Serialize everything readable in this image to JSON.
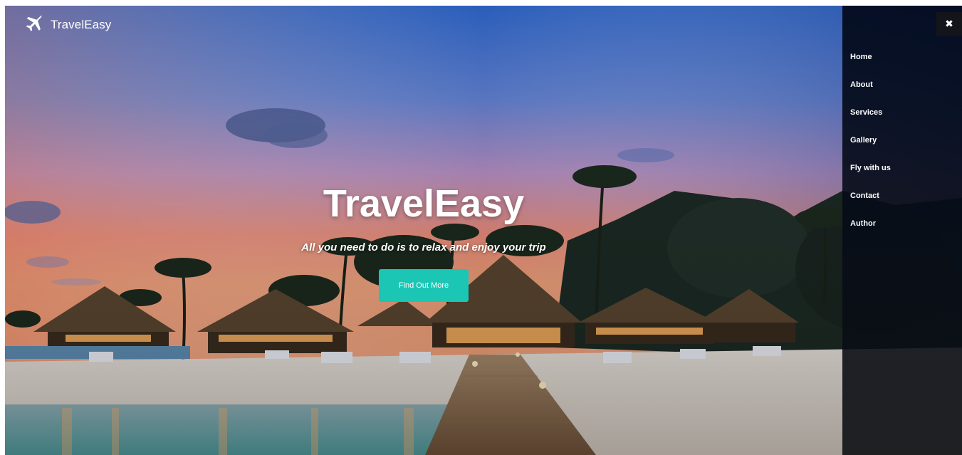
{
  "brand": {
    "name": "TravelEasy",
    "icon": "airplane-icon"
  },
  "hero": {
    "title": "TravelEasy",
    "subtitle": "All you need to do is to relax and enjoy your trip",
    "button_label": "Find Out More"
  },
  "sidebar": {
    "close_symbol": "✖",
    "items": [
      {
        "label": "Home"
      },
      {
        "label": "About"
      },
      {
        "label": "Services"
      },
      {
        "label": "Gallery"
      },
      {
        "label": "Fly with us"
      },
      {
        "label": "Contact"
      },
      {
        "label": "Author"
      }
    ]
  },
  "colors": {
    "accent": "#1bc6b4",
    "sidebar_bg": "#050b1a",
    "sky_top": "#1f58c8",
    "sky_horizon": "#f08a6c"
  }
}
